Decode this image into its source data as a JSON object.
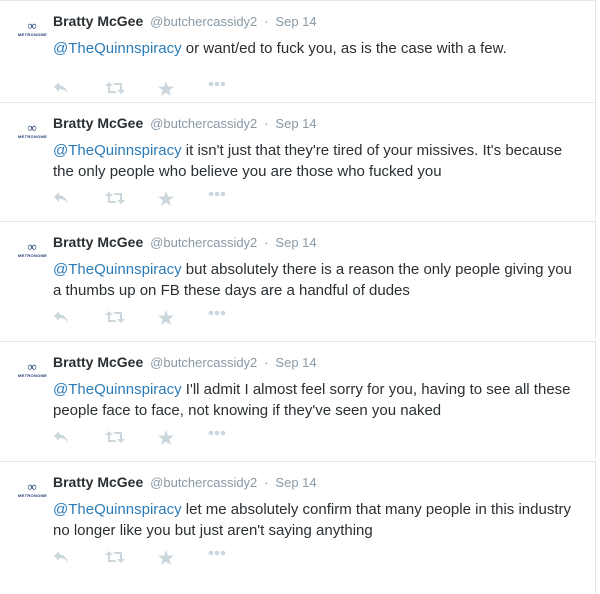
{
  "tweets": [
    {
      "fullname": "Bratty McGee",
      "username": "@butchercassidy2",
      "dot": "·",
      "time": "Sep 14",
      "mention": "@TheQuinnspiracy",
      "text": " or want/ed to fuck you, as is the case with a few."
    },
    {
      "fullname": "Bratty McGee",
      "username": "@butchercassidy2",
      "dot": "·",
      "time": "Sep 14",
      "mention": "@TheQuinnspiracy",
      "text": " it isn't just that they're tired of your missives. It's because the only people who believe you are those who fucked you"
    },
    {
      "fullname": "Bratty McGee",
      "username": "@butchercassidy2",
      "dot": "·",
      "time": "Sep 14",
      "mention": "@TheQuinnspiracy",
      "text": " but absolutely there is a reason the only people giving you a thumbs up on FB these days are a handful of dudes"
    },
    {
      "fullname": "Bratty McGee",
      "username": "@butchercassidy2",
      "dot": "·",
      "time": "Sep 14",
      "mention": "@TheQuinnspiracy",
      "text": " I'll admit I almost feel sorry for you, having to see all these people face to face, not knowing if they've seen you naked"
    },
    {
      "fullname": "Bratty McGee",
      "username": "@butchercassidy2",
      "dot": "·",
      "time": "Sep 14",
      "mention": "@TheQuinnspiracy",
      "text": " let me absolutely confirm that many people in this industry no longer like you but just aren't saying anything"
    }
  ],
  "avatar": {
    "glyph": "∞",
    "text": "METRONOME"
  },
  "actions": {
    "reply_icon": "reply-icon",
    "retweet_icon": "retweet-icon",
    "favorite_icon": "star-icon",
    "more_icon": "more-icon"
  },
  "colors": {
    "link": "#2b7bb9",
    "muted": "#8899a6",
    "icon": "#ccd6dd",
    "border": "#e1e8ed",
    "avatar": "#1f3b73"
  }
}
